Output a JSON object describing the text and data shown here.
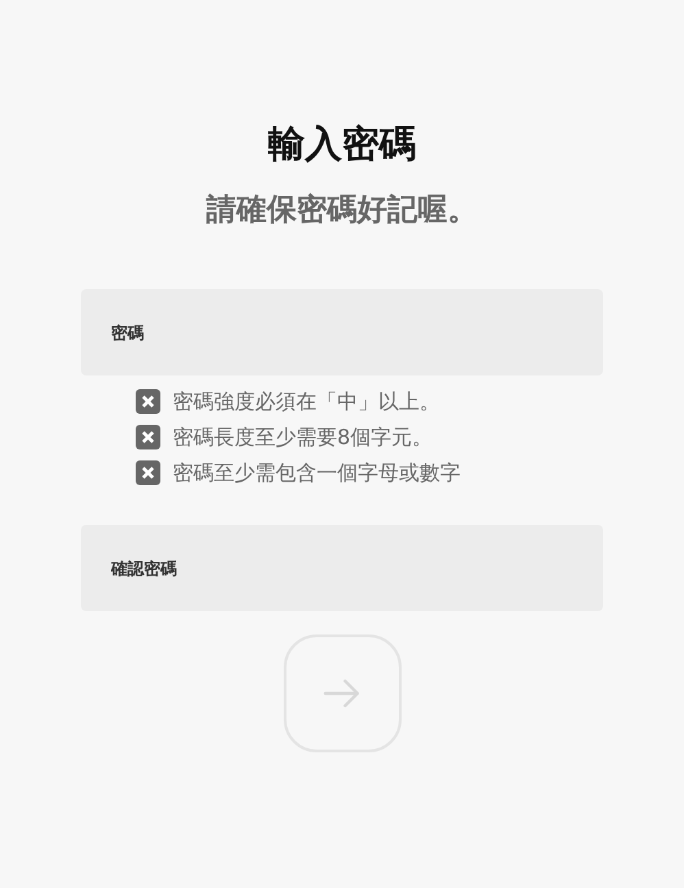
{
  "title": "輸入密碼",
  "subtitle": "請確保密碼好記喔。",
  "password_field": {
    "placeholder": "密碼"
  },
  "rules": [
    {
      "text": "密碼強度必須在「中」以上。",
      "met": false
    },
    {
      "text": "密碼長度至少需要8個字元。",
      "met": false
    },
    {
      "text": "密碼至少需包含一個字母或數字",
      "met": false
    }
  ],
  "confirm_field": {
    "placeholder": "確認密碼"
  },
  "next_button": {
    "disabled": true
  }
}
